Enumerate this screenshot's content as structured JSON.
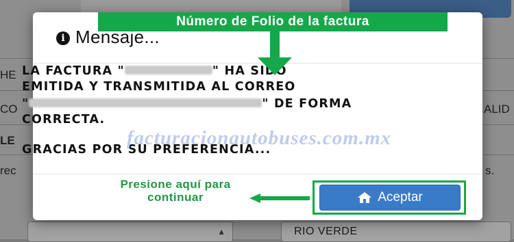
{
  "background": {
    "left_labels": [
      "HE",
      "CO",
      "LE",
      "rec"
    ],
    "right_labels": [
      "ALID",
      "s."
    ],
    "select_left": "",
    "select_right": "RIO VERDE"
  },
  "callout": {
    "text": "Número de Folio de la factura"
  },
  "modal": {
    "title_icon": "info-icon",
    "title": "Mensaje...",
    "body": {
      "l1_a": "LA FACTURA \"",
      "l1_b": "\" HA SIDO",
      "l2": "EMITIDA Y TRANSMITIDA AL CORREO",
      "l3_a": "\"",
      "l3_b": "\" DE FORMA",
      "l4": "CORRECTA.",
      "l5": "GRACIAS POR SU PREFERENCIA..."
    },
    "accept_button": "Aceptar",
    "accept_icon": "home-icon"
  },
  "annotation": {
    "press_text": "Presione aquí para continuar"
  },
  "watermark": "facturacionautobuses.com.mx",
  "colors": {
    "annotation_green": "#15a84a",
    "button_blue": "#3a7bc8"
  }
}
